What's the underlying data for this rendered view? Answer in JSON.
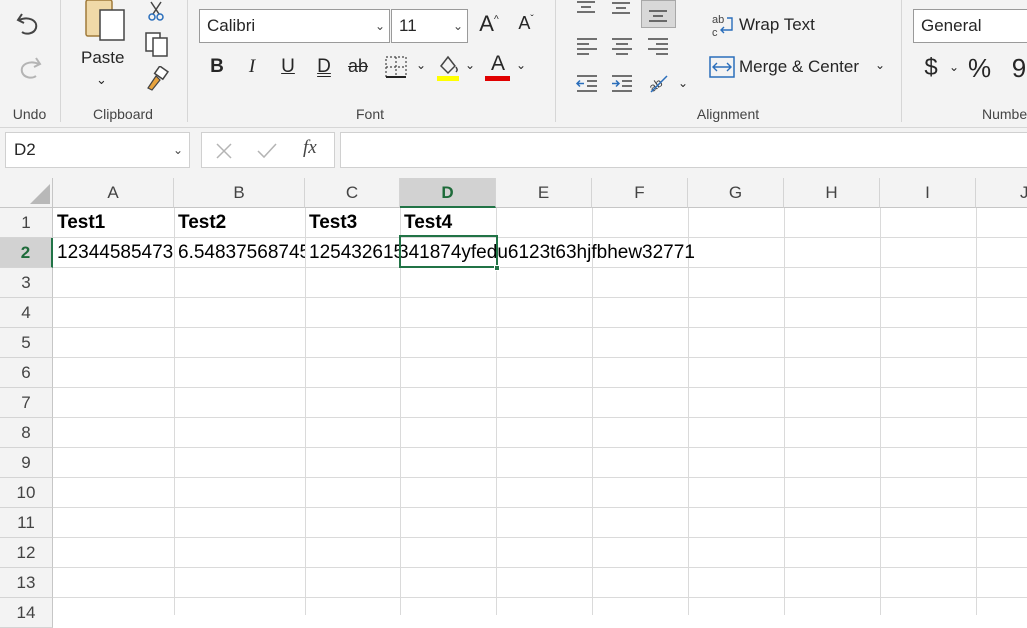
{
  "ribbon": {
    "undo_group_label": "Undo",
    "clipboard": {
      "paste_label": "Paste",
      "group_label": "Clipboard"
    },
    "font": {
      "name": "Calibri",
      "size": "11",
      "group_label": "Font",
      "highlight_color": "#ffff00",
      "font_color": "#e00000"
    },
    "alignment": {
      "wrap_text_label": "Wrap Text",
      "merge_center_label": "Merge & Center",
      "group_label": "Alignment"
    },
    "number": {
      "format": "General",
      "group_label": "Numbe"
    }
  },
  "formula_bar": {
    "name_box": "D2",
    "fx_label": "fx",
    "content": ""
  },
  "grid": {
    "columns": [
      "A",
      "B",
      "C",
      "D",
      "E",
      "F",
      "G",
      "H",
      "I",
      "J"
    ],
    "rows": [
      "1",
      "2",
      "3",
      "4",
      "5",
      "6",
      "7",
      "8",
      "9",
      "10",
      "11",
      "12",
      "13",
      "14"
    ],
    "selected_cell": "D2",
    "cells": {
      "A1": "Test1",
      "B1": "Test2",
      "C1": "Test3",
      "D1": "Test4",
      "A2": "12344585473",
      "B2": "6.54837568745",
      "C2": "125432615",
      "D2": "341874yfedu6123t63hjfbhew32771"
    }
  },
  "accent_color": "#217346"
}
